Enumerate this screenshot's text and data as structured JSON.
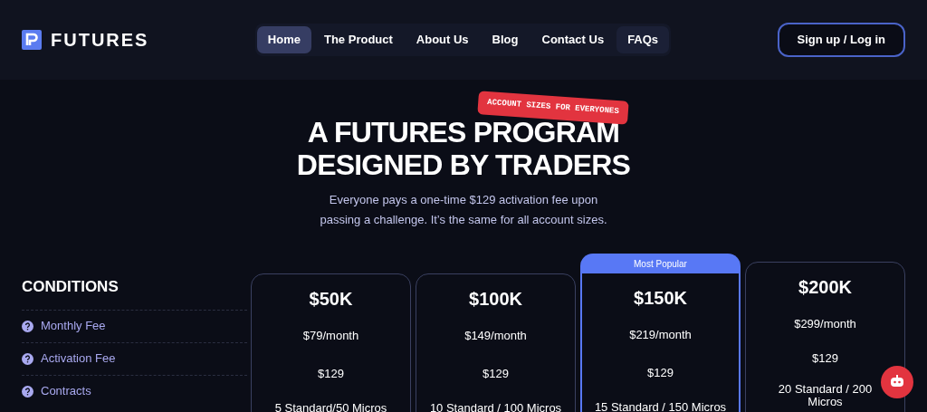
{
  "logo": {
    "text": "FUTURES"
  },
  "nav": [
    {
      "label": "Home",
      "selected": true,
      "highlighted": false
    },
    {
      "label": "The Product",
      "selected": false,
      "highlighted": false
    },
    {
      "label": "About Us",
      "selected": false,
      "highlighted": false
    },
    {
      "label": "Blog",
      "selected": false,
      "highlighted": false
    },
    {
      "label": "Contact Us",
      "selected": false,
      "highlighted": false
    },
    {
      "label": "FAQs",
      "selected": false,
      "highlighted": true
    }
  ],
  "signup_button": "Sign up / Log in",
  "hero": {
    "tag": "ACCOUNT SIZES FOR EVERYONES",
    "title_lines": [
      "A FUTURES PROGRAM",
      "DESIGNED BY TRADERS"
    ],
    "subtitle_lines": [
      "Everyone pays a one-time $129 activation fee upon",
      "passing a challenge. It’s the same for all account sizes."
    ]
  },
  "conditions": {
    "title": "CONDITIONS",
    "rows": [
      "Monthly Fee",
      "Activation Fee",
      "Contracts"
    ]
  },
  "plans": [
    {
      "size": "$50K",
      "monthly": "$79/month",
      "activation": "$129",
      "contracts": [
        "5 Standard/50 Micros"
      ],
      "selected": false
    },
    {
      "size": "$100K",
      "monthly": "$149/month",
      "activation": "$129",
      "contracts": [
        "10 Standard / 100 Micros"
      ],
      "selected": false
    },
    {
      "size": "$150K",
      "badge": "Most Popular",
      "monthly": "$219/month",
      "activation": "$129",
      "contracts": [
        "15 Standard / 150 Micros"
      ],
      "selected": true
    },
    {
      "size": "$200K",
      "monthly": "$299/month",
      "activation": "$129",
      "contracts": [
        "20 Standard / 200",
        "Micros"
      ],
      "selected": false
    }
  ]
}
